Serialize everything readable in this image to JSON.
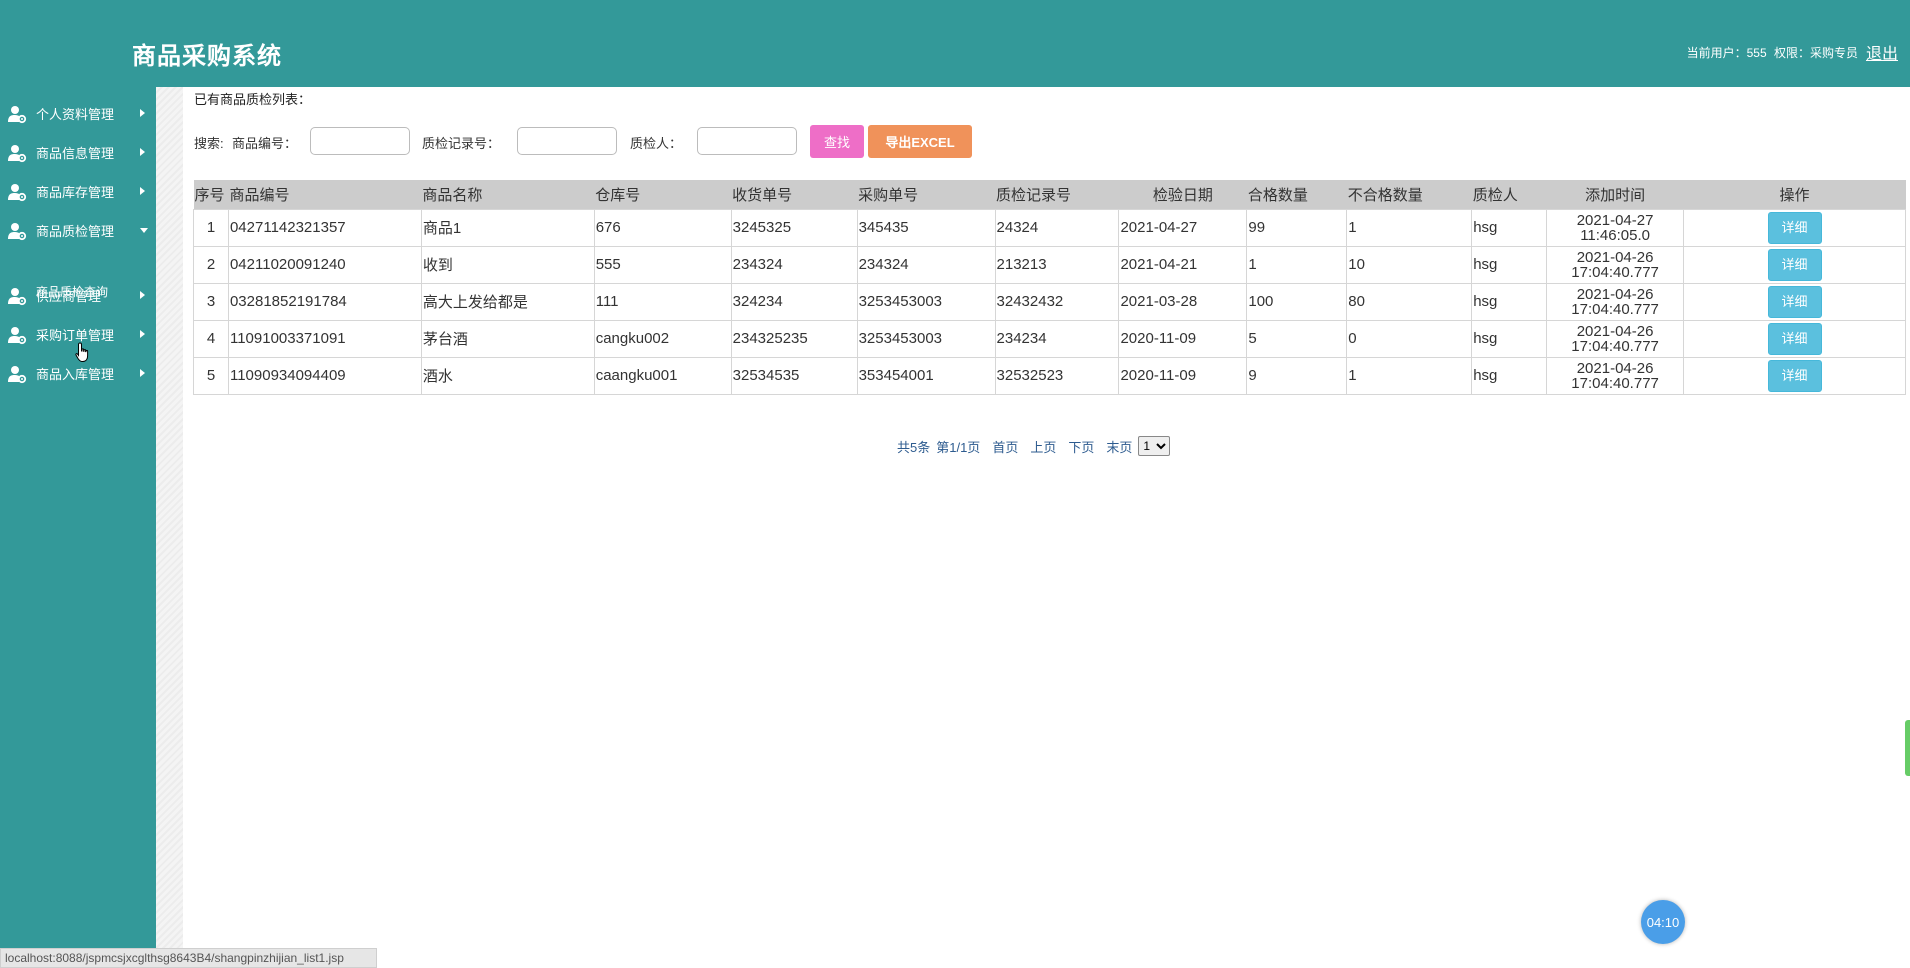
{
  "header": {
    "title": "商品采购系统",
    "user_label": "当前用户：555",
    "role_label": "权限：采购专员",
    "logout": "退出"
  },
  "sidebar": {
    "items": [
      {
        "label": "个人资料管理",
        "icon": "user-gear-icon",
        "expanded": false
      },
      {
        "label": "商品信息管理",
        "icon": "user-gear-icon",
        "expanded": false
      },
      {
        "label": "商品库存管理",
        "icon": "user-gear-icon",
        "expanded": false
      },
      {
        "label": "商品质检管理",
        "icon": "user-gear-icon",
        "expanded": true
      },
      {
        "label": "供应商管理",
        "icon": "user-gear-icon",
        "expanded": false
      },
      {
        "label": "采购订单管理",
        "icon": "user-gear-icon",
        "expanded": false
      },
      {
        "label": "商品入库管理",
        "icon": "user-gear-icon",
        "expanded": false
      }
    ],
    "sub_item": "商品质检查询"
  },
  "content": {
    "list_title": "已有商品质检列表：",
    "search": {
      "prefix": "搜索:",
      "product_no_label": "商品编号：",
      "qc_no_label": "质检记录号：",
      "inspector_label": "质检人：",
      "product_no_value": "",
      "qc_no_value": "",
      "inspector_value": "",
      "find_button": "查找",
      "export_button": "导出EXCEL"
    },
    "table": {
      "columns": [
        "序号",
        "商品编号",
        "商品名称",
        "仓库号",
        "收货单号",
        "采购单号",
        "质检记录号",
        "检验日期",
        "合格数量",
        "不合格数量",
        "质检人",
        "添加时间",
        "操作"
      ],
      "detail_label": "详细",
      "rows": [
        {
          "no": "1",
          "product_no": "04271142321357",
          "name": "商品1",
          "warehouse": "676",
          "receipt_no": "3245325",
          "order_no": "345435",
          "qc_no": "24324",
          "date": "2021-04-27",
          "pass": "99",
          "fail": "1",
          "inspector": "hsg",
          "added_date": "2021-04-27",
          "added_time": "11:46:05.0"
        },
        {
          "no": "2",
          "product_no": "04211020091240",
          "name": "收到",
          "warehouse": "555",
          "receipt_no": "234324",
          "order_no": "234324",
          "qc_no": "213213",
          "date": "2021-04-21",
          "pass": "1",
          "fail": "10",
          "inspector": "hsg",
          "added_date": "2021-04-26",
          "added_time": "17:04:40.777"
        },
        {
          "no": "3",
          "product_no": "03281852191784",
          "name": "高大上发给都是",
          "warehouse": "111",
          "receipt_no": "324234",
          "order_no": "3253453003",
          "qc_no": "32432432",
          "date": "2021-03-28",
          "pass": "100",
          "fail": "80",
          "inspector": "hsg",
          "added_date": "2021-04-26",
          "added_time": "17:04:40.777"
        },
        {
          "no": "4",
          "product_no": "11091003371091",
          "name": "茅台酒",
          "warehouse": "cangku002",
          "receipt_no": "234325235",
          "order_no": "3253453003",
          "qc_no": "234234",
          "date": "2020-11-09",
          "pass": "5",
          "fail": "0",
          "inspector": "hsg",
          "added_date": "2021-04-26",
          "added_time": "17:04:40.777"
        },
        {
          "no": "5",
          "product_no": "11090934094409",
          "name": "酒水",
          "warehouse": "caangku001",
          "receipt_no": "32534535",
          "order_no": "353454001",
          "qc_no": "32532523",
          "date": "2020-11-09",
          "pass": "9",
          "fail": "1",
          "inspector": "hsg",
          "added_date": "2021-04-26",
          "added_time": "17:04:40.777"
        }
      ]
    },
    "pager": {
      "total": "共5条",
      "page": "第1/1页",
      "first": "首页",
      "prev": "上页",
      "next": "下页",
      "last": "末页",
      "selected_page": "1"
    }
  },
  "status_bar": "localhost:8088/jspmcsjxcglthsg8643B4/shangpinzhijian_list1.jsp",
  "timer": "04:10",
  "colors": {
    "header_bg": "#339999",
    "find_btn": "#ee6ec7",
    "export_btn": "#f0925a",
    "detail_btn": "#5bc0de"
  }
}
